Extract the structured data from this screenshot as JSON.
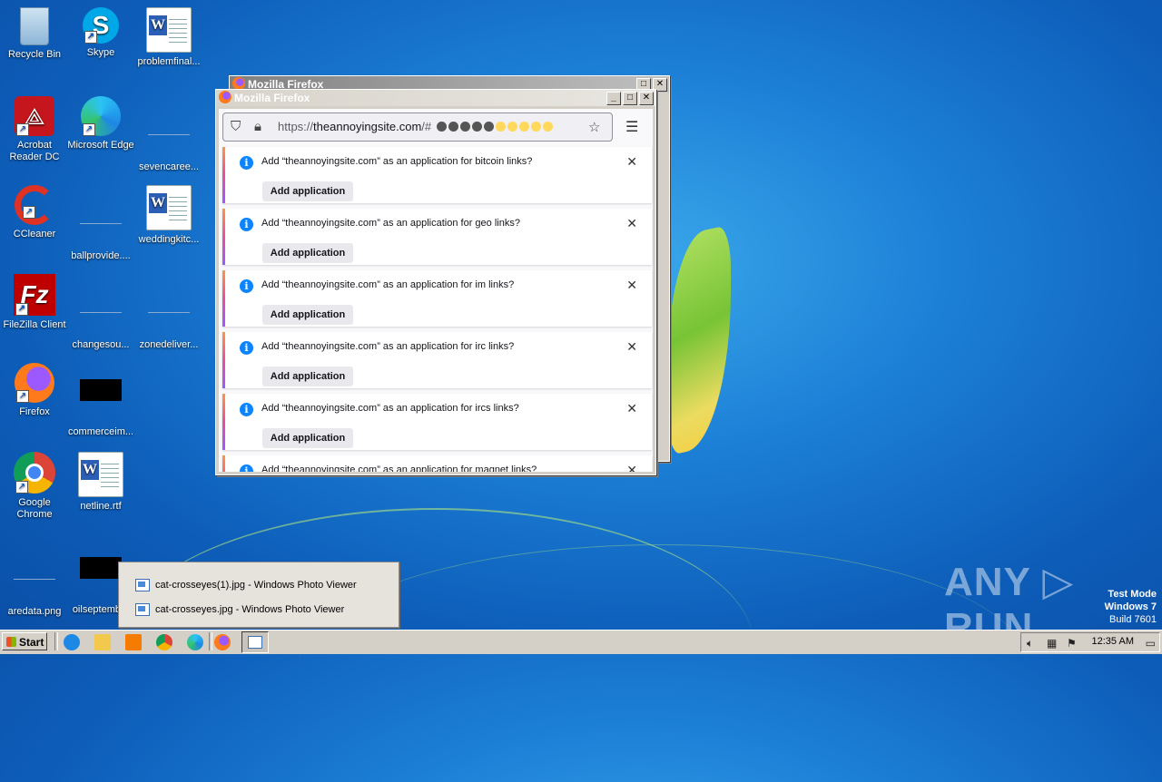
{
  "desktop": {
    "icons": [
      {
        "label": "Recycle Bin"
      },
      {
        "label": "Skype"
      },
      {
        "label": "problemfinal..."
      },
      {
        "label": "Acrobat Reader DC"
      },
      {
        "label": "Microsoft Edge"
      },
      {
        "label": "sevencaree..."
      },
      {
        "label": "CCleaner"
      },
      {
        "label": "ballprovide...."
      },
      {
        "label": "weddingkitc..."
      },
      {
        "label": "FileZilla Client"
      },
      {
        "label": "changesou..."
      },
      {
        "label": "zonedeliver..."
      },
      {
        "label": "Firefox"
      },
      {
        "label": "commerceim..."
      },
      {
        "label": "Google Chrome"
      },
      {
        "label": "netline.rtf"
      },
      {
        "label": "aredata.png"
      },
      {
        "label": "oilseptemb..."
      }
    ]
  },
  "firefox_back": {
    "title": "Mozilla Firefox"
  },
  "firefox": {
    "title": "Mozilla Firefox",
    "url_prefix": "https://",
    "url_domain": "theannoyingsite.com",
    "url_suffix": "/#",
    "url_dot_colors": [
      "#555555",
      "#555555",
      "#555555",
      "#555555",
      "#555555",
      "#ffd85c",
      "#ffd85c",
      "#ffd85c",
      "#ffd85c",
      "#ffd85c"
    ],
    "notifications": [
      {
        "message": "Add “theannoyingsite.com” as an application for bitcoin links?",
        "button": "Add application"
      },
      {
        "message": "Add “theannoyingsite.com” as an application for geo links?",
        "button": "Add application"
      },
      {
        "message": "Add “theannoyingsite.com” as an application for im links?",
        "button": "Add application"
      },
      {
        "message": "Add “theannoyingsite.com” as an application for irc links?",
        "button": "Add application"
      },
      {
        "message": "Add “theannoyingsite.com” as an application for ircs links?",
        "button": "Add application"
      },
      {
        "message": "Add “theannoyingsite.com” as an application for magnet links?",
        "button": ""
      }
    ]
  },
  "taskbar_popup": {
    "items": [
      {
        "label": "cat-crosseyes(1).jpg - Windows Photo Viewer"
      },
      {
        "label": "cat-crosseyes.jpg - Windows Photo Viewer"
      }
    ]
  },
  "watermark": {
    "text": "ANY ▷ RUN"
  },
  "test_mode": {
    "line1": "Test Mode",
    "line2": "Windows 7",
    "line3": "Build 7601"
  },
  "taskbar": {
    "start_label": "Start",
    "clock": "12:35 AM"
  }
}
